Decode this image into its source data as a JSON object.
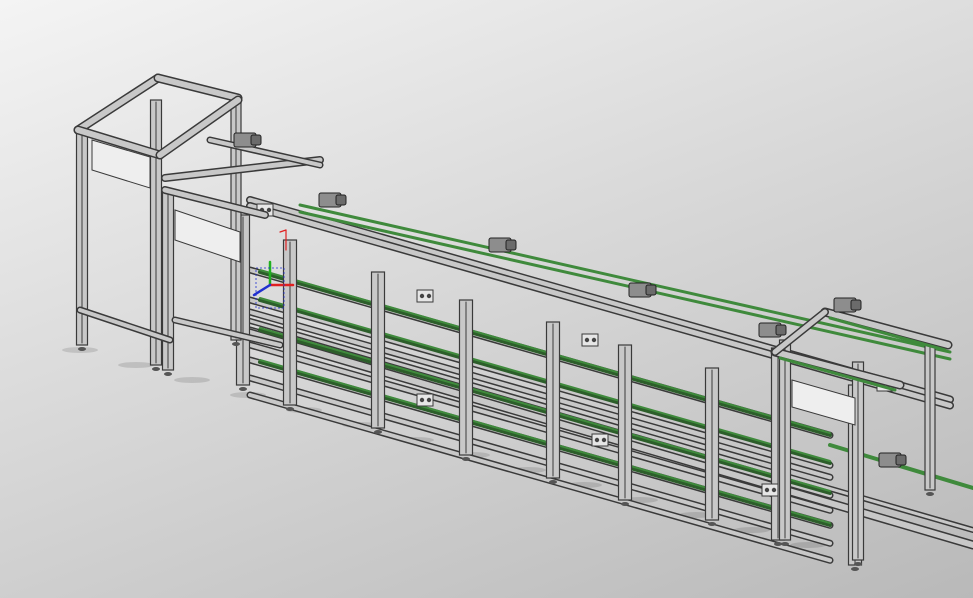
{
  "viewport": {
    "background_top": "#f4f4f4",
    "background_bottom": "#b9b9b9"
  },
  "model": {
    "frame_color": "#3a3a3a",
    "frame_fill": "#c8c8c8",
    "belt_color": "#3f8a3c",
    "belt_dark": "#2c5e2a",
    "panel_fill": "#eeeeee"
  },
  "triad": {
    "x_color": "#e02020",
    "y_color": "#20b020",
    "z_color": "#2030d0",
    "origin_icon": "coordinate-triad-icon"
  }
}
